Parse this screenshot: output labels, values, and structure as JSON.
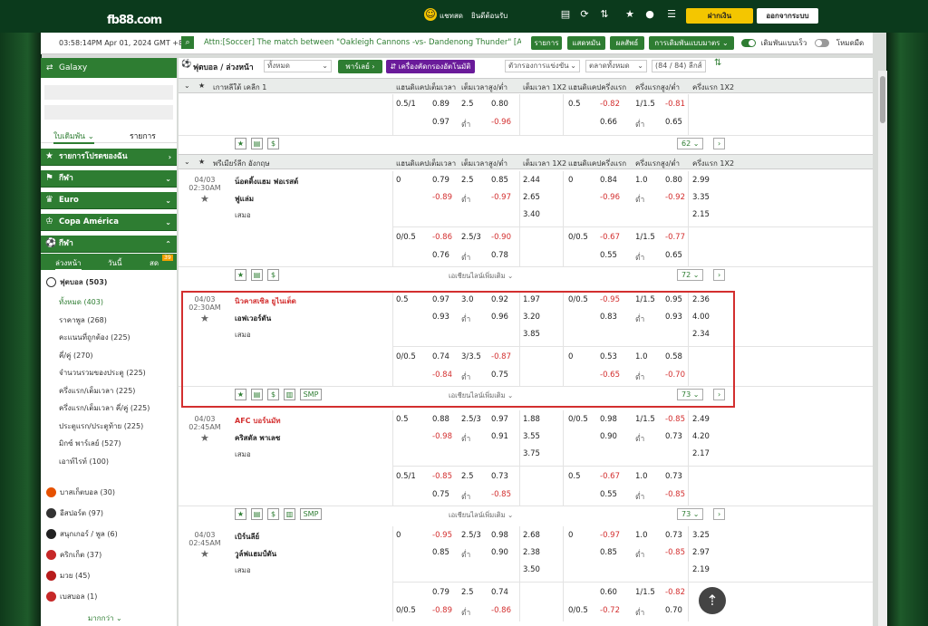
{
  "header": {
    "logo": "fb88",
    "logo_suffix": ".com",
    "user_label": "แชทสด",
    "account_text": "ยินดีต้อนรับ",
    "deposit": "ฝากเงิน",
    "logout": "ออกจากระบบ"
  },
  "ticker": {
    "time": "03:58:14PM Apr 01, 2024 GMT +8",
    "message": "Attn:[Soccer] The match between \"Oakleigh Cannons -vs- Dandenong Thunder\" [AUSTRALIA",
    "btn_list": "รายการ",
    "btn_live": "แสดหมัน",
    "btn_results": "ผลสัพธ์",
    "btn_bets": "การเดิมพันแบบมาตร",
    "toggle_fast": "เดิมพันแบบเร็ว",
    "toggle_dark": "โหมดมืด"
  },
  "sidebar": {
    "galaxy": "Galaxy",
    "tab_bets": "ใบเดิมพัน",
    "tab_list": "รายการ",
    "categories": [
      "รายการโปรดของฉัน",
      "กีฬา",
      "Euro",
      "Copa América",
      "กีฬา"
    ],
    "subtabs": [
      "ล่วงหน้า",
      "วันนี้",
      "สด"
    ],
    "live_count": "39",
    "soccer": "ฟุตบอล (503)",
    "sub_items": [
      "ทั้งหมด (403)",
      "ราคาพูล (268)",
      "คะแนนที่ถูกต้อง (225)",
      "คี่/คู่ (270)",
      "จำนวนรวมของประตู (225)",
      "ครึ่งแรก/เต็มเวลา (225)",
      "ครึ่งแรก/เต็มเวลา คี่/คู่ (225)",
      "ประตูแรก/ประตูท้าย (225)",
      "มิกซ์ พาร์เลย์ (527)",
      "เอาท์ไรท์ (100)"
    ],
    "sports": [
      "บาสเก็ตบอล (30)",
      "อีสปอร์ต (97)",
      "สนุกเกอร์ / พูล (6)",
      "คริกเก็ต (37)",
      "มวย (45)",
      "เบสบอล (1)"
    ],
    "more": "มากกว่า"
  },
  "filter": {
    "sport": "ฟุตบอล / ล่วงหน้า",
    "all": "ทั้งหมด",
    "parlay": "พาร์เลย์",
    "tool": "เครื่องคัดกรองอัตโนมัติ",
    "sort": "ตัวกรองการแข่งขัน",
    "markets": "ตลาดทั้งหมด",
    "leagues": "(84 / 84) ลีกส์"
  },
  "columns": [
    "แฮนดิแคปเต็มเวลา",
    "เต็มเวลาสูง/ต่ำ",
    "เต็มเวลา 1X2",
    "แฮนดิแคปครึ่งแรก",
    "ครึ่งแรกสูง/ต่ำ",
    "ครึ่งแรก 1X2"
  ],
  "league1": {
    "name": "เกาหลีใต้ เคลีก 1",
    "rows": [
      [
        "0.5/1",
        "0.89",
        "2.5",
        "0.80",
        "",
        "0.5",
        "-0.82",
        "1/1.5",
        "-0.81",
        ""
      ],
      [
        "",
        "0.97",
        "ต่ำ",
        "-0.96",
        "",
        "",
        "0.66",
        "ต่ำ",
        "0.65",
        ""
      ]
    ],
    "page": "62"
  },
  "league2": {
    "name": "พรีเมียร์ลีก อังกฤษ",
    "more": "เอเชียนไลน์เพิ่มเติม",
    "matches": [
      {
        "date": "04/03",
        "time": "02:30AM",
        "home": "น็อตติ้งแฮม ฟอเรสต์",
        "away": "ฟูแล่ม",
        "draw": "เสมอ",
        "home_red": false,
        "a": [
          [
            "0",
            "0.79",
            "2.5",
            "0.85",
            "2.44",
            "0",
            "0.84",
            "1.0",
            "0.80",
            "2.99"
          ],
          [
            "",
            "-0.89",
            "ต่ำ",
            "-0.97",
            "2.65",
            "",
            "-0.96",
            "ต่ำ",
            "-0.92",
            "3.35"
          ],
          [
            "",
            "",
            "",
            "",
            "3.40",
            "",
            "",
            "",
            "",
            "2.15"
          ]
        ],
        "b": [
          [
            "0/0.5",
            "-0.86",
            "2.5/3",
            "-0.90",
            "",
            "0/0.5",
            "-0.67",
            "1/1.5",
            "-0.77",
            ""
          ],
          [
            "",
            "0.76",
            "ต่ำ",
            "0.78",
            "",
            "",
            "0.55",
            "ต่ำ",
            "0.65",
            ""
          ]
        ],
        "page": "72"
      },
      {
        "date": "04/03",
        "time": "02:30AM",
        "home": "นิวคาสเซิล ยูไนเต็ด",
        "away": "เอฟเวอร์ตัน",
        "draw": "เสมอ",
        "home_red": true,
        "a": [
          [
            "0.5",
            "0.97",
            "3.0",
            "0.92",
            "1.97",
            "0/0.5",
            "-0.95",
            "1/1.5",
            "0.95",
            "2.36"
          ],
          [
            "",
            "0.93",
            "ต่ำ",
            "0.96",
            "3.20",
            "",
            "0.83",
            "ต่ำ",
            "0.93",
            "4.00"
          ],
          [
            "",
            "",
            "",
            "",
            "3.85",
            "",
            "",
            "",
            "",
            "2.34"
          ]
        ],
        "b": [
          [
            "0/0.5",
            "0.74",
            "3/3.5",
            "-0.87",
            "",
            "0",
            "0.53",
            "1.0",
            "0.58",
            ""
          ],
          [
            "",
            "-0.84",
            "ต่ำ",
            "0.75",
            "",
            "",
            "-0.65",
            "ต่ำ",
            "-0.70",
            ""
          ]
        ],
        "page": "73"
      },
      {
        "date": "04/03",
        "time": "02:45AM",
        "home": "AFC บอร์นมัท",
        "away": "คริสตัล พาเลซ",
        "draw": "เสมอ",
        "home_red": true,
        "a": [
          [
            "0.5",
            "0.88",
            "2.5/3",
            "0.97",
            "1.88",
            "0/0.5",
            "0.98",
            "1/1.5",
            "-0.85",
            "2.49"
          ],
          [
            "",
            "-0.98",
            "ต่ำ",
            "0.91",
            "3.55",
            "",
            "0.90",
            "ต่ำ",
            "0.73",
            "4.20"
          ],
          [
            "",
            "",
            "",
            "",
            "3.75",
            "",
            "",
            "",
            "",
            "2.17"
          ]
        ],
        "b": [
          [
            "0.5/1",
            "-0.85",
            "2.5",
            "0.73",
            "",
            "0.5",
            "-0.67",
            "1.0",
            "0.73",
            ""
          ],
          [
            "",
            "0.75",
            "ต่ำ",
            "-0.85",
            "",
            "",
            "0.55",
            "ต่ำ",
            "-0.85",
            ""
          ]
        ],
        "page": "73"
      },
      {
        "date": "04/03",
        "time": "02:45AM",
        "home": "เบิร์นลีย์",
        "away": "วูล์ฟแฮมป์ตัน",
        "draw": "เสมอ",
        "home_red": false,
        "a": [
          [
            "0",
            "-0.95",
            "2.5/3",
            "0.98",
            "2.68",
            "0",
            "-0.97",
            "1.0",
            "0.73",
            "3.25"
          ],
          [
            "",
            "0.85",
            "ต่ำ",
            "0.90",
            "2.38",
            "",
            "0.85",
            "ต่ำ",
            "-0.85",
            "2.97"
          ],
          [
            "",
            "",
            "",
            "",
            "3.50",
            "",
            "",
            "",
            "",
            "2.19"
          ]
        ],
        "b": [
          [
            "",
            "0.79",
            "2.5",
            "0.74",
            "",
            "",
            "0.60",
            "1/1.5",
            "-0.82",
            ""
          ],
          [
            "0/0.5",
            "-0.89",
            "ต่ำ",
            "-0.86",
            "",
            "0/0.5",
            "-0.72",
            "ต่ำ",
            "0.70",
            ""
          ]
        ],
        "page": ""
      }
    ]
  },
  "smp": "SMP"
}
